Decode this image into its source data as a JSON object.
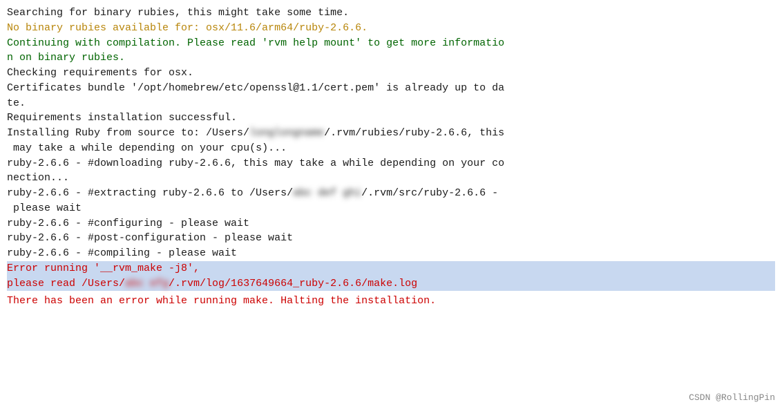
{
  "terminal": {
    "lines": [
      {
        "id": "line1",
        "type": "black",
        "text": "Searching for binary rubies, this might take some time."
      },
      {
        "id": "line2",
        "type": "yellow",
        "text": "No binary rubies available for: osx/11.6/arm64/ruby-2.6.6."
      },
      {
        "id": "line3",
        "type": "green-dark",
        "text": "Continuing with compilation. Please read 'rvm help mount' to get more informatio\nn on binary rubies."
      },
      {
        "id": "line4",
        "type": "black",
        "text": "Checking requirements for osx."
      },
      {
        "id": "line5",
        "type": "black",
        "text": "Certificates bundle '/opt/homebrew/etc/openssl@1.1/cert.pem' is already up to da\nte."
      },
      {
        "id": "line6",
        "type": "black",
        "text": "Requirements installation successful."
      },
      {
        "id": "line7",
        "type": "black",
        "text": "Installing Ruby from source to: /Users/",
        "blurred": "longlongname",
        "text2": "/.rvm/rubies/ruby-2.6.6, this\n may take a while depending on your cpu(s)..."
      },
      {
        "id": "line8",
        "type": "black",
        "text": "ruby-2.6.6 - #downloading ruby-2.6.6, this may take a while depending on your co\nnection..."
      },
      {
        "id": "line9",
        "type": "black",
        "text": "ruby-2.6.6 - #extracting ruby-2.6.6 to /Users/",
        "blurred2": "abc def ghi",
        "text2": "/.rvm/src/ruby-2.6.6 -\n please wait"
      },
      {
        "id": "line10",
        "type": "black",
        "text": "ruby-2.6.6 - #configuring - please wait"
      },
      {
        "id": "line11",
        "type": "black",
        "text": "ruby-2.6.6 - #post-configuration - please wait"
      },
      {
        "id": "line12",
        "type": "black",
        "text": "ruby-2.6.6 - #compiling - please wait"
      }
    ],
    "error_lines": [
      {
        "id": "err1",
        "text": "Error running '__rvm_make -j8',"
      },
      {
        "id": "err2",
        "text_before": "please read /Users/",
        "blurred": "abc efg",
        "text_after": "/.rvm/log/1637649664_ruby-2.6.6/make.log"
      }
    ],
    "bottom_error": "There has been an error while running make. Halting the installation.",
    "watermark": "CSDN @RollingPin"
  }
}
